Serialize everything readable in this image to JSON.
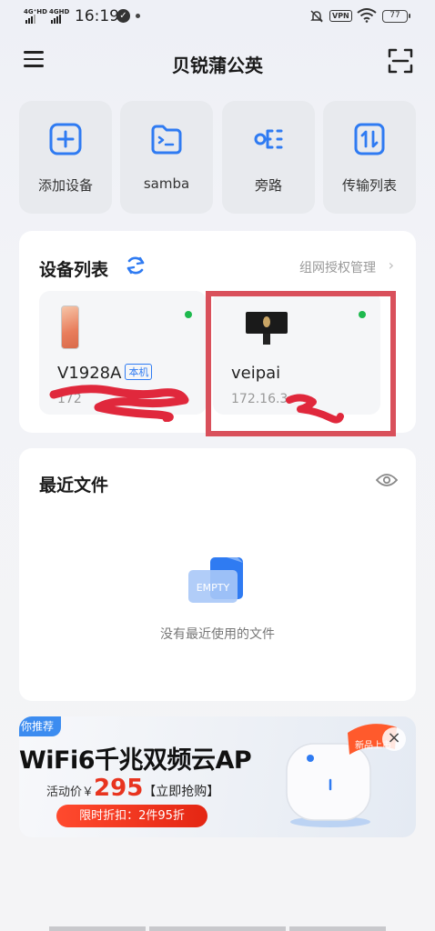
{
  "status_bar": {
    "net1": "4G⁺HD",
    "net2": "4GHD",
    "time": "16:19",
    "vpn": "VPN",
    "battery": "77"
  },
  "header": {
    "title": "贝锐蒲公英"
  },
  "tiles": [
    {
      "label": "添加设备",
      "icon": "add-device-icon"
    },
    {
      "label": "samba",
      "icon": "samba-folder-icon"
    },
    {
      "label": "旁路",
      "icon": "bypass-icon"
    },
    {
      "label": "传输列表",
      "icon": "transfer-list-icon"
    }
  ],
  "devices": {
    "title": "设备列表",
    "auth_link": "组网授权管理",
    "items": [
      {
        "name": "V1928A",
        "badge": "本机",
        "ip": "172",
        "status_color": "#1eb94e"
      },
      {
        "name": "veipai",
        "ip": "172.16.3",
        "status_color": "#1eb94e"
      }
    ]
  },
  "recent": {
    "title": "最近文件",
    "empty_label": "EMPTY",
    "empty_text": "没有最近使用的文件"
  },
  "banner": {
    "tag": "你推荐",
    "headline": "WiFi6千兆双频云AP",
    "price_label": "活动价￥",
    "price": "295",
    "buy": "【立即抢购】",
    "discount": "限时折扣：2件95折",
    "new_badge": "新品上市"
  },
  "colors": {
    "accent": "#2f7bf2",
    "online": "#1eb94e",
    "highlight": "#d9505b",
    "price": "#e8341f"
  }
}
